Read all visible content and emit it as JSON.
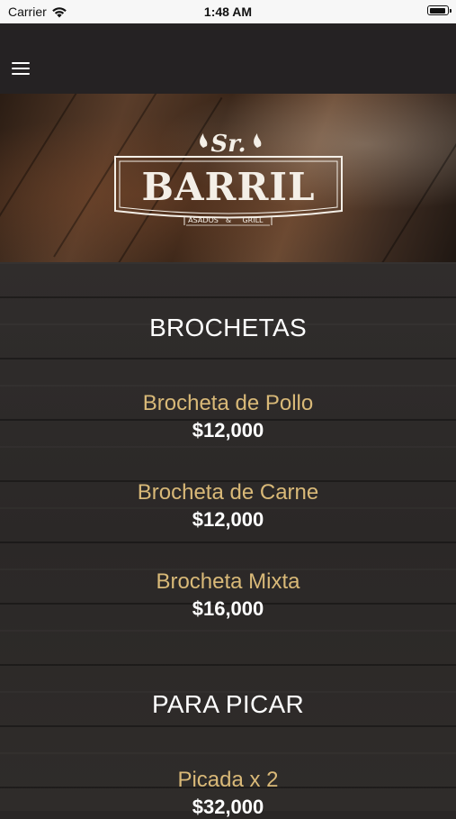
{
  "status_bar": {
    "carrier": "Carrier",
    "time": "1:48 AM"
  },
  "nav": {
    "menu_icon": "hamburger-menu-icon"
  },
  "logo": {
    "top_text": "Sr.",
    "main_text": "BARRIL",
    "left_sub": "ASADOS",
    "amp": "&",
    "right_sub": "GRILL"
  },
  "sections": [
    {
      "title": "BROCHETAS",
      "items": [
        {
          "name": "Brocheta de Pollo",
          "price": "$12,000"
        },
        {
          "name": "Brocheta de Carne",
          "price": "$12,000"
        },
        {
          "name": "Brocheta Mixta",
          "price": "$16,000"
        }
      ]
    },
    {
      "title": "PARA PICAR",
      "items": [
        {
          "name": "Picada x 2",
          "price": "$32,000"
        }
      ]
    }
  ],
  "colors": {
    "item_name": "#d9b978",
    "price": "#ffffff",
    "nav_bg": "#252223"
  }
}
